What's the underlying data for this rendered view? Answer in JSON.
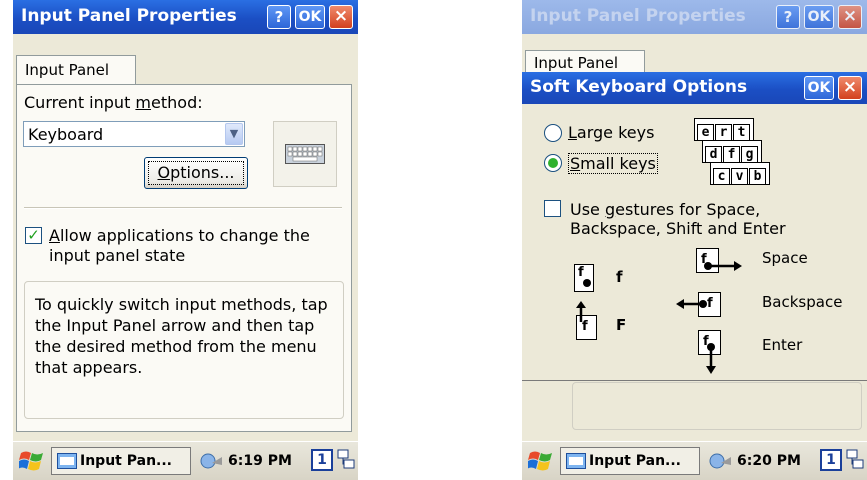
{
  "left_screen": {
    "title": "Input Panel Properties",
    "help_btn": "?",
    "ok_btn": "OK",
    "close_btn": "×",
    "tab": "Input Panel",
    "current_method_label_pre": "Current input ",
    "current_method_label_u": "m",
    "current_method_label_post": "ethod:",
    "method_value": "Keyboard",
    "options_btn_u": "O",
    "options_btn_rest": "ptions...",
    "allow_u": "A",
    "allow_rest": "llow applications to change the",
    "allow_line2": "input panel state",
    "allow_checked": true,
    "info_text": "To quickly switch input methods, tap the Input Panel arrow and then tap the desired method from the menu that appears.",
    "taskbar": {
      "task_label": "Input Pan...",
      "clock": "6:19 PM",
      "badge": "1"
    }
  },
  "right_screen": {
    "bg_title": "Input Panel Properties",
    "bg_tab": "Input Panel",
    "dialog_title": "Soft Keyboard Options",
    "ok_btn": "OK",
    "close_btn": "×",
    "large_keys_u": "L",
    "large_keys_rest": "arge keys",
    "small_keys_u": "S",
    "small_keys_rest": "mall keys",
    "selected_size": "small",
    "key_rows": [
      [
        "e",
        "r",
        "t"
      ],
      [
        "d",
        "f",
        "g"
      ],
      [
        "c",
        "v",
        "b"
      ]
    ],
    "gestures_pre": "Use ",
    "gestures_u": "g",
    "gestures_rest": "estures for Space,",
    "gestures_line2": "Backspace, Shift and Enter",
    "gestures_checked": false,
    "gesture_f_label": "f",
    "gesture_F_label": "F",
    "gesture_space": "Space",
    "gesture_backspace": "Backspace",
    "gesture_enter": "Enter",
    "taskbar": {
      "task_label": "Input Pan...",
      "clock": "6:20 PM",
      "badge": "1"
    }
  }
}
